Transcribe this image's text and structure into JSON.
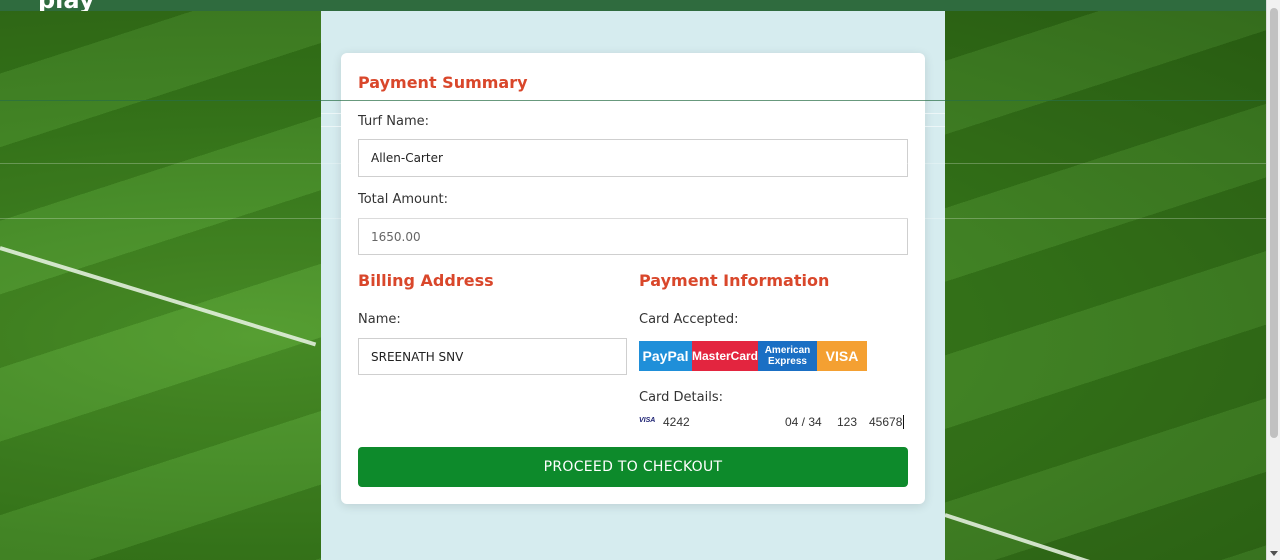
{
  "brand": {
    "name": "play"
  },
  "payment_summary": {
    "heading": "Payment Summary",
    "turf_label": "Turf Name:",
    "turf_value": "Allen-Carter",
    "amount_label": "Total Amount:",
    "amount_value": "1650.00"
  },
  "billing": {
    "heading": "Billing Address",
    "name_label": "Name:",
    "name_value": "SREENATH SNV"
  },
  "payment_info": {
    "heading": "Payment Information",
    "accepted_label": "Card Accepted:",
    "cards": [
      "PayPal",
      "MasterCard",
      "American Express",
      "VISA"
    ],
    "details_label": "Card Details:",
    "card_brand_icon": "VISA",
    "card_number": "4242",
    "expiry": "04 / 34",
    "cvc": "123",
    "zip": "45678"
  },
  "checkout_button": "PROCEED TO CHECKOUT",
  "colors": {
    "accent_heading": "#d9472b",
    "checkout_green": "#0d8a2b",
    "panel_bg": "#d6ecef",
    "topbar": "#2f6b3e"
  }
}
